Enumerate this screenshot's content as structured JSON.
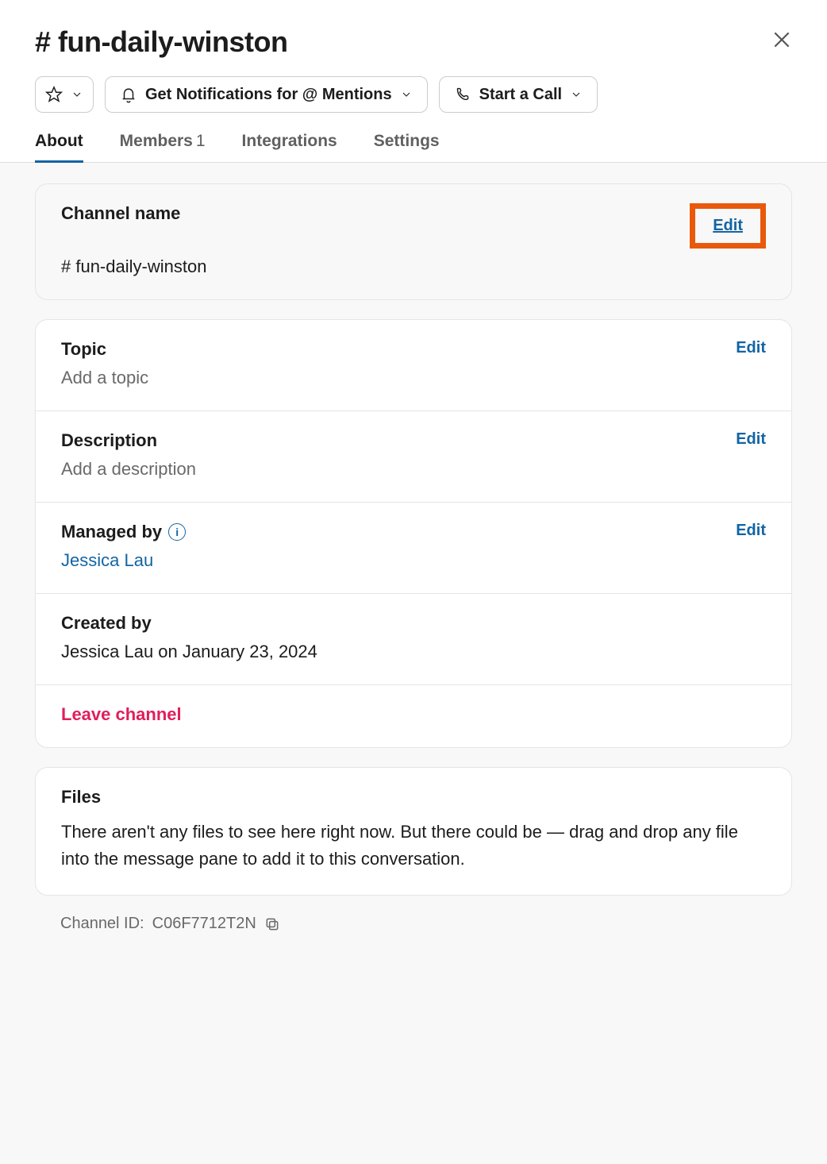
{
  "header": {
    "title": "# fun-daily-winston",
    "notifications_label": "Get Notifications for @ Mentions",
    "start_call_label": "Start a Call"
  },
  "tabs": {
    "about": "About",
    "members_label": "Members",
    "members_count": "1",
    "integrations": "Integrations",
    "settings": "Settings"
  },
  "channel_name": {
    "label": "Channel name",
    "value": "# fun-daily-winston",
    "edit": "Edit"
  },
  "topic": {
    "label": "Topic",
    "placeholder": "Add a topic",
    "edit": "Edit"
  },
  "description": {
    "label": "Description",
    "placeholder": "Add a description",
    "edit": "Edit"
  },
  "managed_by": {
    "label": "Managed by",
    "value": "Jessica Lau",
    "edit": "Edit"
  },
  "created_by": {
    "label": "Created by",
    "value": "Jessica Lau on January 23, 2024"
  },
  "leave_label": "Leave channel",
  "files": {
    "label": "Files",
    "text": "There aren't any files to see here right now. But there could be — drag and drop any file into the message pane to add it to this conversation."
  },
  "channel_id": {
    "prefix": "Channel ID: ",
    "value": "C06F7712T2N"
  }
}
